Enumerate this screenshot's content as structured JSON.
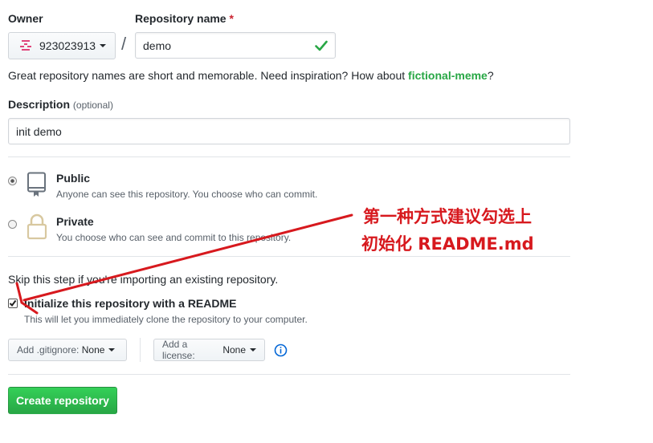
{
  "owner": {
    "label": "Owner",
    "value": "923023913"
  },
  "repo": {
    "label": "Repository name",
    "required_mark": "*",
    "value": "demo"
  },
  "separator": "/",
  "hint": {
    "text": "Great repository names are short and memorable. Need inspiration? How about ",
    "suggestion": "fictional-meme",
    "end": "?"
  },
  "description": {
    "label": "Description",
    "optional": "(optional)",
    "value": "init demo"
  },
  "visibility": {
    "public": {
      "title": "Public",
      "desc": "Anyone can see this repository. You choose who can commit."
    },
    "private": {
      "title": "Private",
      "desc": "You choose who can see and commit to this repository."
    }
  },
  "skip_text": "Skip this step if you're importing an existing repository.",
  "init": {
    "label": "Initialize this repository with a README",
    "desc": "This will let you immediately clone the repository to your computer.",
    "checked": true
  },
  "gitignore": {
    "prefix": "Add .gitignore:",
    "value": "None"
  },
  "license": {
    "prefix": "Add a license:",
    "value": "None"
  },
  "create_button": "Create repository",
  "annotation": {
    "line1": "第一种方式建议勾选上",
    "line2": "初始化 README.md"
  },
  "colors": {
    "accent_green": "#28a745",
    "annotation_red": "#d7191e",
    "link": "#0366d6"
  }
}
